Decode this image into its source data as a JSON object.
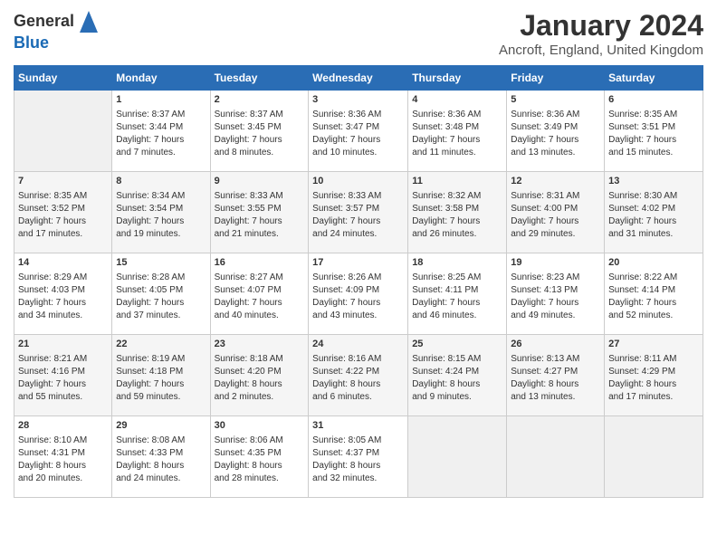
{
  "header": {
    "logo_general": "General",
    "logo_blue": "Blue",
    "main_title": "January 2024",
    "subtitle": "Ancroft, England, United Kingdom"
  },
  "columns": [
    "Sunday",
    "Monday",
    "Tuesday",
    "Wednesday",
    "Thursday",
    "Friday",
    "Saturday"
  ],
  "weeks": [
    [
      {
        "day": "",
        "info": ""
      },
      {
        "day": "1",
        "info": "Sunrise: 8:37 AM\nSunset: 3:44 PM\nDaylight: 7 hours\nand 7 minutes."
      },
      {
        "day": "2",
        "info": "Sunrise: 8:37 AM\nSunset: 3:45 PM\nDaylight: 7 hours\nand 8 minutes."
      },
      {
        "day": "3",
        "info": "Sunrise: 8:36 AM\nSunset: 3:47 PM\nDaylight: 7 hours\nand 10 minutes."
      },
      {
        "day": "4",
        "info": "Sunrise: 8:36 AM\nSunset: 3:48 PM\nDaylight: 7 hours\nand 11 minutes."
      },
      {
        "day": "5",
        "info": "Sunrise: 8:36 AM\nSunset: 3:49 PM\nDaylight: 7 hours\nand 13 minutes."
      },
      {
        "day": "6",
        "info": "Sunrise: 8:35 AM\nSunset: 3:51 PM\nDaylight: 7 hours\nand 15 minutes."
      }
    ],
    [
      {
        "day": "7",
        "info": "Sunrise: 8:35 AM\nSunset: 3:52 PM\nDaylight: 7 hours\nand 17 minutes."
      },
      {
        "day": "8",
        "info": "Sunrise: 8:34 AM\nSunset: 3:54 PM\nDaylight: 7 hours\nand 19 minutes."
      },
      {
        "day": "9",
        "info": "Sunrise: 8:33 AM\nSunset: 3:55 PM\nDaylight: 7 hours\nand 21 minutes."
      },
      {
        "day": "10",
        "info": "Sunrise: 8:33 AM\nSunset: 3:57 PM\nDaylight: 7 hours\nand 24 minutes."
      },
      {
        "day": "11",
        "info": "Sunrise: 8:32 AM\nSunset: 3:58 PM\nDaylight: 7 hours\nand 26 minutes."
      },
      {
        "day": "12",
        "info": "Sunrise: 8:31 AM\nSunset: 4:00 PM\nDaylight: 7 hours\nand 29 minutes."
      },
      {
        "day": "13",
        "info": "Sunrise: 8:30 AM\nSunset: 4:02 PM\nDaylight: 7 hours\nand 31 minutes."
      }
    ],
    [
      {
        "day": "14",
        "info": "Sunrise: 8:29 AM\nSunset: 4:03 PM\nDaylight: 7 hours\nand 34 minutes."
      },
      {
        "day": "15",
        "info": "Sunrise: 8:28 AM\nSunset: 4:05 PM\nDaylight: 7 hours\nand 37 minutes."
      },
      {
        "day": "16",
        "info": "Sunrise: 8:27 AM\nSunset: 4:07 PM\nDaylight: 7 hours\nand 40 minutes."
      },
      {
        "day": "17",
        "info": "Sunrise: 8:26 AM\nSunset: 4:09 PM\nDaylight: 7 hours\nand 43 minutes."
      },
      {
        "day": "18",
        "info": "Sunrise: 8:25 AM\nSunset: 4:11 PM\nDaylight: 7 hours\nand 46 minutes."
      },
      {
        "day": "19",
        "info": "Sunrise: 8:23 AM\nSunset: 4:13 PM\nDaylight: 7 hours\nand 49 minutes."
      },
      {
        "day": "20",
        "info": "Sunrise: 8:22 AM\nSunset: 4:14 PM\nDaylight: 7 hours\nand 52 minutes."
      }
    ],
    [
      {
        "day": "21",
        "info": "Sunrise: 8:21 AM\nSunset: 4:16 PM\nDaylight: 7 hours\nand 55 minutes."
      },
      {
        "day": "22",
        "info": "Sunrise: 8:19 AM\nSunset: 4:18 PM\nDaylight: 7 hours\nand 59 minutes."
      },
      {
        "day": "23",
        "info": "Sunrise: 8:18 AM\nSunset: 4:20 PM\nDaylight: 8 hours\nand 2 minutes."
      },
      {
        "day": "24",
        "info": "Sunrise: 8:16 AM\nSunset: 4:22 PM\nDaylight: 8 hours\nand 6 minutes."
      },
      {
        "day": "25",
        "info": "Sunrise: 8:15 AM\nSunset: 4:24 PM\nDaylight: 8 hours\nand 9 minutes."
      },
      {
        "day": "26",
        "info": "Sunrise: 8:13 AM\nSunset: 4:27 PM\nDaylight: 8 hours\nand 13 minutes."
      },
      {
        "day": "27",
        "info": "Sunrise: 8:11 AM\nSunset: 4:29 PM\nDaylight: 8 hours\nand 17 minutes."
      }
    ],
    [
      {
        "day": "28",
        "info": "Sunrise: 8:10 AM\nSunset: 4:31 PM\nDaylight: 8 hours\nand 20 minutes."
      },
      {
        "day": "29",
        "info": "Sunrise: 8:08 AM\nSunset: 4:33 PM\nDaylight: 8 hours\nand 24 minutes."
      },
      {
        "day": "30",
        "info": "Sunrise: 8:06 AM\nSunset: 4:35 PM\nDaylight: 8 hours\nand 28 minutes."
      },
      {
        "day": "31",
        "info": "Sunrise: 8:05 AM\nSunset: 4:37 PM\nDaylight: 8 hours\nand 32 minutes."
      },
      {
        "day": "",
        "info": ""
      },
      {
        "day": "",
        "info": ""
      },
      {
        "day": "",
        "info": ""
      }
    ]
  ]
}
